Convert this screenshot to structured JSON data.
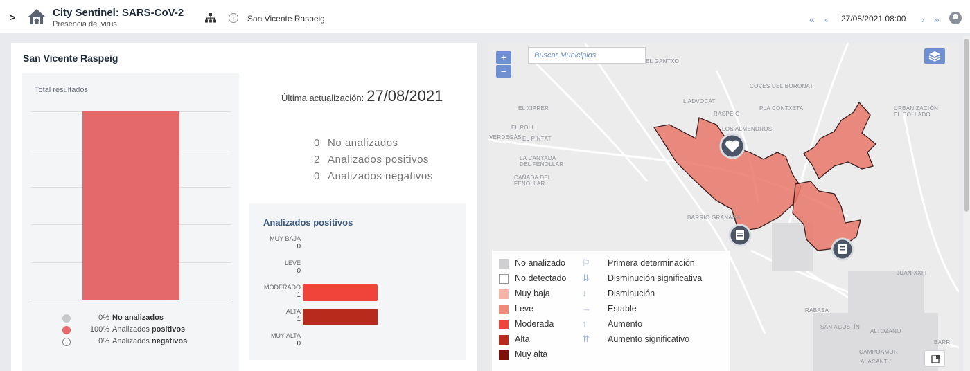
{
  "header": {
    "title": "City Sentinel: SARS-CoV-2",
    "subtitle": "Presencia del virus",
    "location": "San Vicente Raspeig",
    "date": "27/08/2021 08:00",
    "nav_first": "«",
    "nav_prev": "‹",
    "nav_next": "›",
    "nav_last": "»"
  },
  "panel": {
    "title": "San Vicente Raspeig",
    "total_label": "Total resultados",
    "last_update_label": "Última actualización:",
    "last_update_value": "27/08/2021",
    "counts": [
      {
        "value": "0",
        "label": "No analizados"
      },
      {
        "value": "2",
        "label": "Analizados positivos"
      },
      {
        "value": "0",
        "label": "Analizados negativos"
      }
    ],
    "legend": [
      {
        "pct": "0%",
        "prefix": "",
        "bold": "No analizados",
        "color": "#c8c9cb"
      },
      {
        "pct": "100%",
        "prefix": "Analizados ",
        "bold": "positivos",
        "color": "#e4696a"
      },
      {
        "pct": "0%",
        "prefix": "Analizados ",
        "bold": "negativos",
        "color": "#ffffff"
      }
    ]
  },
  "positivos": {
    "title": "Analizados positivos",
    "levels": [
      {
        "label": "MUY BAJA",
        "value": "0",
        "count": 0,
        "color": "#f6b4a6"
      },
      {
        "label": "LEVE",
        "value": "0",
        "count": 0,
        "color": "#ef8a7a"
      },
      {
        "label": "MODERADO",
        "value": "1",
        "count": 1,
        "color": "#f0433a"
      },
      {
        "label": "ALTA",
        "value": "1",
        "count": 1,
        "color": "#b72a1c"
      },
      {
        "label": "MUY ALTA",
        "value": "0",
        "count": 0,
        "color": "#7d1108"
      }
    ]
  },
  "chart_data": [
    {
      "type": "bar",
      "title": "Total resultados",
      "categories": [
        "No analizados",
        "Analizados positivos",
        "Analizados negativos"
      ],
      "values": [
        0,
        100,
        0
      ],
      "unit": "%",
      "bar_color": "#e4696a"
    },
    {
      "type": "bar",
      "orientation": "horizontal",
      "title": "Analizados positivos",
      "categories": [
        "MUY BAJA",
        "LEVE",
        "MODERADO",
        "ALTA",
        "MUY ALTA"
      ],
      "values": [
        0,
        0,
        1,
        1,
        0
      ]
    }
  ],
  "map": {
    "search_placeholder": "Buscar Municipios",
    "zoom_in": "+",
    "zoom_out": "−",
    "place_labels": [
      "EL GANTXO",
      "COVES DEL BORONAT",
      "L'ADVOCAT",
      "PLA CONTXETA",
      "URBANIZACIÓN EL COLLADO",
      "EL XIPRER",
      "RASPEIG",
      "LOS ALMENDROS",
      "EL POLL",
      "VERDEGÀS",
      "EL PINTAT",
      "LA CANYADA DEL FENOLLAR",
      "CAÑADA DEL FENOLLAR",
      "BARRIO GRANADA",
      "JUAN XXIII",
      "RABASA",
      "SAN AGUSTÍN",
      "ALTOZANO",
      "CAMPOAMOR",
      "ALACANT /",
      "BARRI"
    ],
    "legend_levels": [
      {
        "label": "No analizado",
        "color": "#cfcfd1"
      },
      {
        "label": "No detectado",
        "color": "#ffffff"
      },
      {
        "label": "Muy baja",
        "color": "#f6b4a6"
      },
      {
        "label": "Leve",
        "color": "#ef8a7a"
      },
      {
        "label": "Moderada",
        "color": "#f0433a"
      },
      {
        "label": "Alta",
        "color": "#b72a1c"
      },
      {
        "label": "Muy alta",
        "color": "#7d1108"
      }
    ],
    "legend_trends": [
      {
        "label": "Primera determinación",
        "icon": "flag-icon",
        "glyph": "⚐"
      },
      {
        "label": "Disminución significativa",
        "icon": "double-arrow-down-icon",
        "glyph": "⇊"
      },
      {
        "label": "Disminución",
        "icon": "arrow-down-icon",
        "glyph": "↓"
      },
      {
        "label": "Estable",
        "icon": "arrow-right-icon",
        "glyph": "→"
      },
      {
        "label": "Aumento",
        "icon": "arrow-up-icon",
        "glyph": "↑"
      },
      {
        "label": "Aumento significativo",
        "icon": "double-arrow-up-icon",
        "glyph": "⇈"
      }
    ]
  }
}
